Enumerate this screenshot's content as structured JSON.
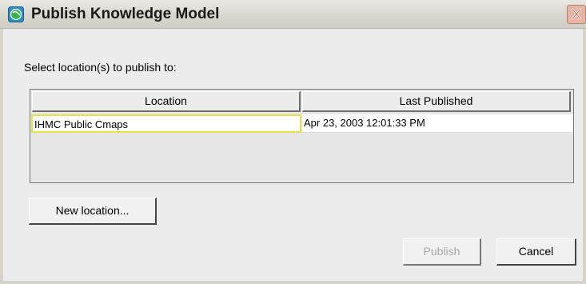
{
  "window": {
    "title": "Publish Knowledge Model",
    "app_icon": "cmap-globe-icon",
    "close_icon": "close-x-icon"
  },
  "dialog": {
    "prompt": "Select location(s) to publish to:",
    "table": {
      "headers": [
        "Location",
        "Last Published"
      ],
      "rows": [
        {
          "location": "IHMC Public Cmaps",
          "last_published": "Apr 23, 2003 12:01:33 PM"
        }
      ]
    },
    "new_location_label": "New location...",
    "publish_label": "Publish",
    "cancel_label": "Cancel"
  },
  "colors": {
    "selected_cell_border": "#e5e34a",
    "disabled_text": "#a8a8a8",
    "close_button": "#e7b3a3"
  }
}
